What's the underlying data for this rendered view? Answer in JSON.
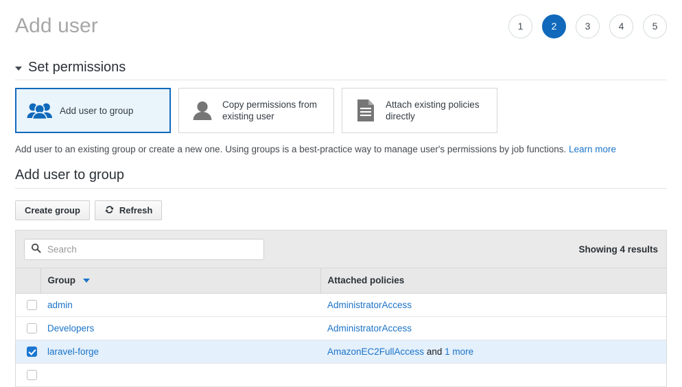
{
  "header": {
    "title": "Add user",
    "steps": [
      {
        "label": "1",
        "active": false
      },
      {
        "label": "2",
        "active": true
      },
      {
        "label": "3",
        "active": false
      },
      {
        "label": "4",
        "active": false
      },
      {
        "label": "5",
        "active": false
      }
    ],
    "active_step": 2,
    "accent_color": "#1069bb"
  },
  "permissions_section": {
    "title": "Set permissions",
    "collapsed": false,
    "cards": [
      {
        "label": "Add user to group",
        "icon": "group-users-icon",
        "selected": true
      },
      {
        "label": "Copy permissions from existing user",
        "icon": "user-silhouette-icon",
        "selected": false
      },
      {
        "label": "Attach existing policies directly",
        "icon": "document-lines-icon",
        "selected": false
      }
    ],
    "description": "Add user to an existing group or create a new one. Using groups is a best-practice way to manage user's permissions by job functions.",
    "learn_more": "Learn more"
  },
  "group_section": {
    "title": "Add user to group",
    "buttons": {
      "create_group": "Create group",
      "refresh": "Refresh"
    },
    "search": {
      "placeholder": "Search",
      "value": ""
    },
    "results_count": "Showing 4 results",
    "columns": [
      "Group",
      "Attached policies"
    ],
    "sorted_by": "Group",
    "rows": [
      {
        "checked": false,
        "group": "admin",
        "policies": [
          {
            "text": "AdministratorAccess",
            "link": true
          }
        ]
      },
      {
        "checked": false,
        "group": "Developers",
        "policies": [
          {
            "text": "AdministratorAccess",
            "link": true
          }
        ]
      },
      {
        "checked": true,
        "group": "laravel-forge",
        "policies": [
          {
            "text": "AmazonEC2FullAccess",
            "link": true
          },
          {
            "text": " and ",
            "link": false
          },
          {
            "text": "1 more",
            "link": true
          }
        ]
      },
      {
        "checked": false,
        "group": "",
        "policies": []
      }
    ]
  }
}
